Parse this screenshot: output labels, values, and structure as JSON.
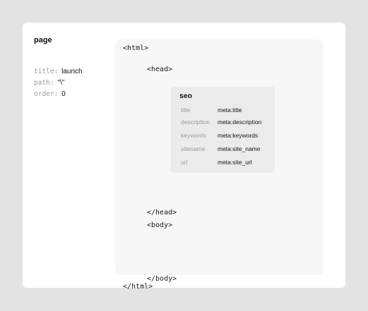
{
  "page": {
    "title": "page",
    "properties": [
      {
        "key": "title:",
        "value": "launch"
      },
      {
        "key": "path:",
        "value": "\"\\\""
      },
      {
        "key": "order:",
        "value": "0"
      }
    ]
  },
  "template": {
    "html_open": "<html>",
    "head_open": "<head>",
    "head_close": "</head>",
    "body_open": "<body>",
    "body_close": "</body>",
    "html_close": "</html>"
  },
  "seo": {
    "title": "seo",
    "rows": [
      {
        "key": "title",
        "value": "meta:title"
      },
      {
        "key": "description",
        "value": "meta:description"
      },
      {
        "key": "keywords",
        "value": "meta:keywords"
      },
      {
        "key": "sitename",
        "value": "meta:site_name"
      },
      {
        "key": "url",
        "value": "meta:site_url"
      }
    ]
  }
}
